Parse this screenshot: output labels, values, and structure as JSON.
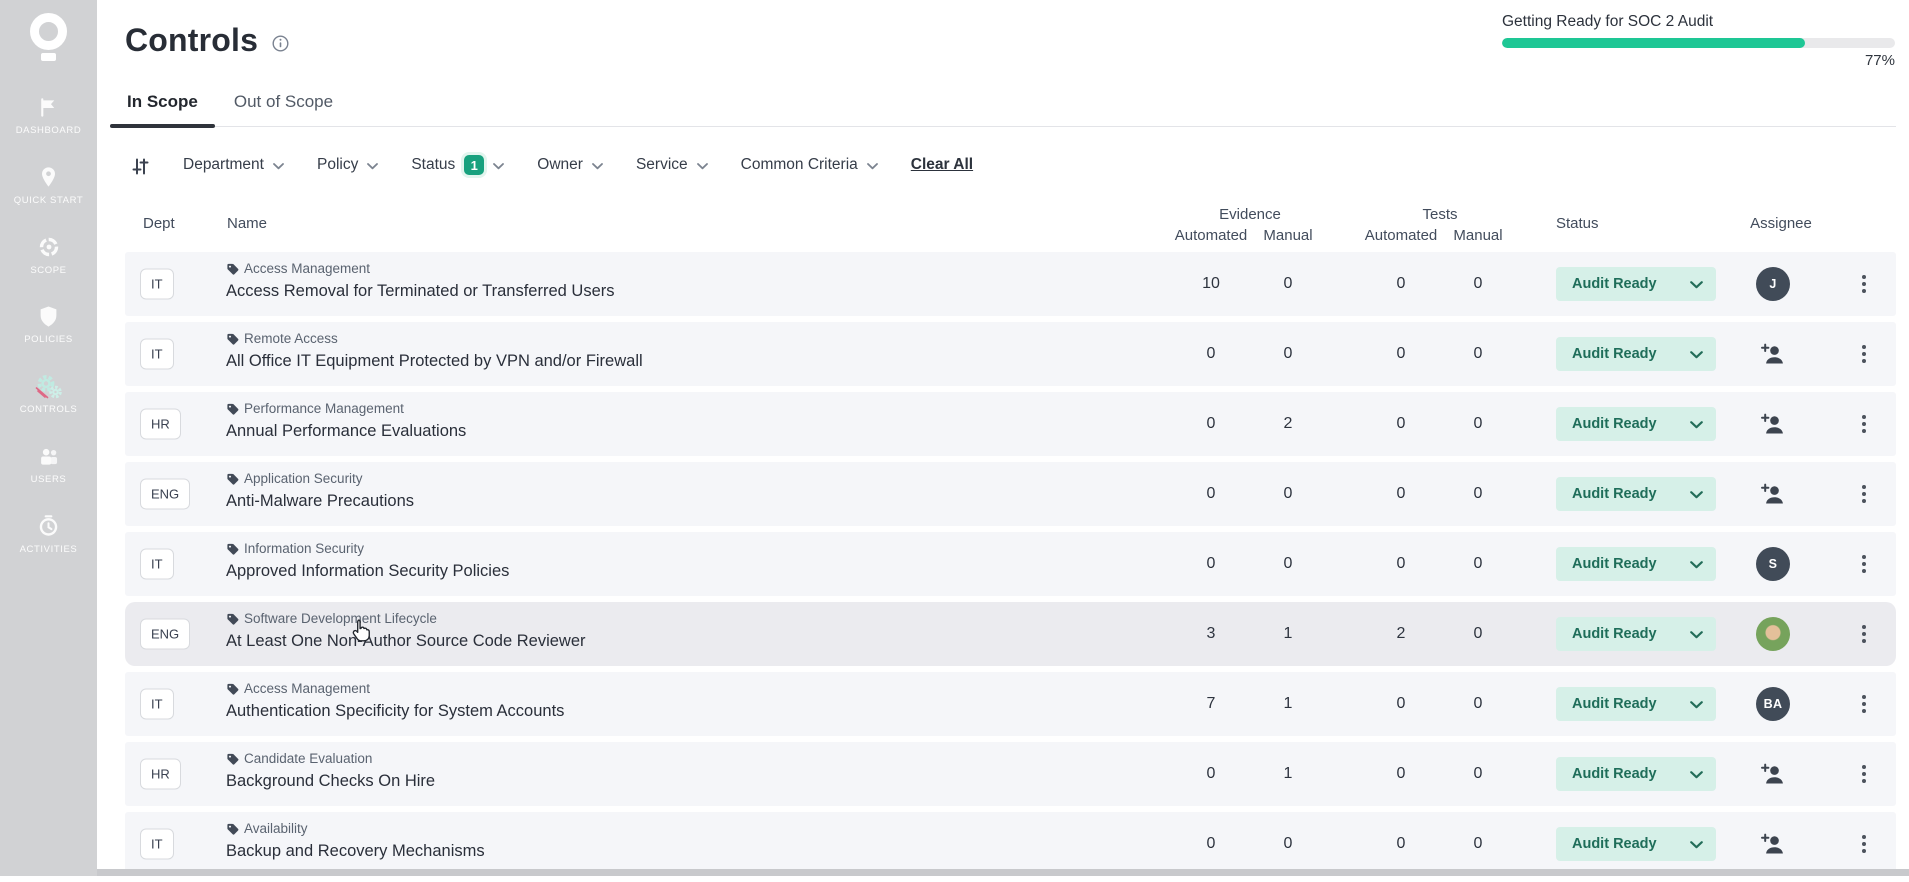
{
  "header": {
    "title": "Controls",
    "info_icon": "info-icon",
    "progress": {
      "label": "Getting Ready for SOC 2 Audit",
      "percent": 77,
      "percent_label": "77%"
    }
  },
  "sidebar": {
    "items": [
      {
        "id": "dashboard",
        "label": "DASHBOARD",
        "icon": "flag-icon",
        "active": false
      },
      {
        "id": "quick-start",
        "label": "QUICK START",
        "icon": "pin-icon",
        "active": false
      },
      {
        "id": "scope",
        "label": "SCOPE",
        "icon": "target-icon",
        "active": false
      },
      {
        "id": "policies",
        "label": "POLICIES",
        "icon": "shield-icon",
        "active": false
      },
      {
        "id": "controls",
        "label": "CONTROLS",
        "icon": "gears-icon",
        "active": true
      },
      {
        "id": "users",
        "label": "USERS",
        "icon": "users-icon",
        "active": false
      },
      {
        "id": "activities",
        "label": "ACTIVITIES",
        "icon": "clock-icon",
        "active": false
      }
    ]
  },
  "tabs": [
    {
      "label": "In Scope",
      "active": true
    },
    {
      "label": "Out of Scope",
      "active": false
    }
  ],
  "filters": {
    "icon": "filter-sliders-icon",
    "items": [
      {
        "label": "Department"
      },
      {
        "label": "Policy"
      },
      {
        "label": "Status",
        "badge": "1"
      },
      {
        "label": "Owner"
      },
      {
        "label": "Service"
      },
      {
        "label": "Common Criteria"
      }
    ],
    "clear_all": "Clear All"
  },
  "table": {
    "headers": {
      "dept": "Dept",
      "name": "Name",
      "evidence": "Evidence",
      "tests": "Tests",
      "automated": "Automated",
      "manual": "Manual",
      "status": "Status",
      "assignee": "Assignee"
    },
    "rows": [
      {
        "dept": "IT",
        "category": "Access Management",
        "name": "Access Removal for Terminated or Transferred Users",
        "ev_auto": "10",
        "ev_man": "0",
        "t_auto": "0",
        "t_man": "0",
        "status": "Audit Ready",
        "assignee": {
          "type": "initials",
          "value": "J"
        },
        "hover": false
      },
      {
        "dept": "IT",
        "category": "Remote Access",
        "name": "All Office IT Equipment Protected by VPN and/or Firewall",
        "ev_auto": "0",
        "ev_man": "0",
        "t_auto": "0",
        "t_man": "0",
        "status": "Audit Ready",
        "assignee": {
          "type": "add"
        },
        "hover": false
      },
      {
        "dept": "HR",
        "category": "Performance Management",
        "name": "Annual Performance Evaluations",
        "ev_auto": "0",
        "ev_man": "2",
        "t_auto": "0",
        "t_man": "0",
        "status": "Audit Ready",
        "assignee": {
          "type": "add"
        },
        "hover": false
      },
      {
        "dept": "ENG",
        "category": "Application Security",
        "name": "Anti-Malware Precautions",
        "ev_auto": "0",
        "ev_man": "0",
        "t_auto": "0",
        "t_man": "0",
        "status": "Audit Ready",
        "assignee": {
          "type": "add"
        },
        "hover": false
      },
      {
        "dept": "IT",
        "category": "Information Security",
        "name": "Approved Information Security Policies",
        "ev_auto": "0",
        "ev_man": "0",
        "t_auto": "0",
        "t_man": "0",
        "status": "Audit Ready",
        "assignee": {
          "type": "initials",
          "value": "S"
        },
        "hover": false
      },
      {
        "dept": "ENG",
        "category": "Software Development Lifecycle",
        "name": "At Least One Non-Author Source Code Reviewer",
        "ev_auto": "3",
        "ev_man": "1",
        "t_auto": "2",
        "t_man": "0",
        "status": "Audit Ready",
        "assignee": {
          "type": "photo"
        },
        "hover": true
      },
      {
        "dept": "IT",
        "category": "Access Management",
        "name": "Authentication Specificity for System Accounts",
        "ev_auto": "7",
        "ev_man": "1",
        "t_auto": "0",
        "t_man": "0",
        "status": "Audit Ready",
        "assignee": {
          "type": "initials",
          "value": "BA"
        },
        "hover": false
      },
      {
        "dept": "HR",
        "category": "Candidate Evaluation",
        "name": "Background Checks On Hire",
        "ev_auto": "0",
        "ev_man": "1",
        "t_auto": "0",
        "t_man": "0",
        "status": "Audit Ready",
        "assignee": {
          "type": "add"
        },
        "hover": false
      },
      {
        "dept": "IT",
        "category": "Availability",
        "name": "Backup and Recovery Mechanisms",
        "ev_auto": "0",
        "ev_man": "0",
        "t_auto": "0",
        "t_man": "0",
        "status": "Audit Ready",
        "assignee": {
          "type": "add"
        },
        "hover": false
      }
    ]
  },
  "colors": {
    "accent_teal": "#1ec795",
    "filter_badge_bg": "#18a17e",
    "status_pill_bg": "#d6f0e8",
    "status_pill_text": "#1f6e5a",
    "avatar_bg": "#414b58",
    "sidebar_bg": "#d1d2d4",
    "row_bg": "#f5f6f9",
    "row_hover_bg": "#ebebef"
  }
}
